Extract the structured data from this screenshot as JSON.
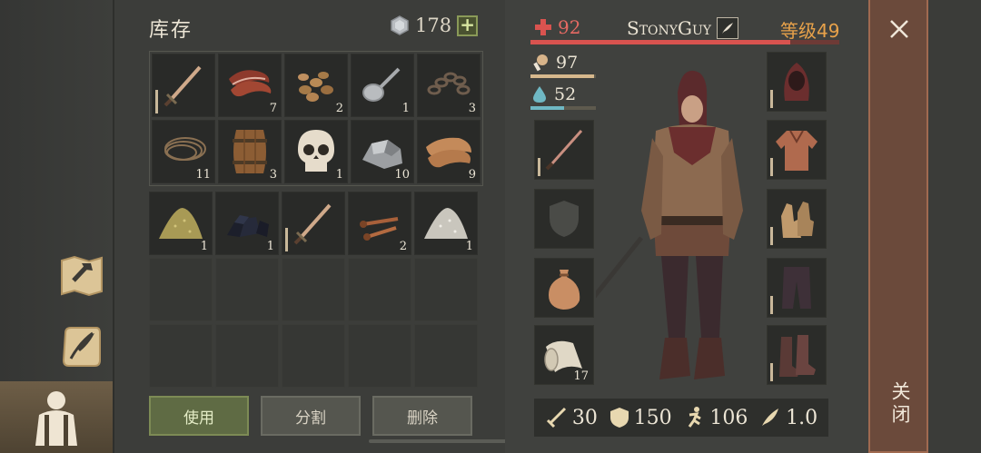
{
  "inventory": {
    "title": "库存",
    "silver": "178",
    "add_icon": "plus-icon",
    "top_grid": [
      {
        "name": "sword",
        "qty": ""
      },
      {
        "name": "bacon",
        "qty": "7"
      },
      {
        "name": "seeds",
        "qty": "2"
      },
      {
        "name": "spoon",
        "qty": "1"
      },
      {
        "name": "chain",
        "qty": "3"
      },
      {
        "name": "rope",
        "qty": "11"
      },
      {
        "name": "barrel",
        "qty": "3"
      },
      {
        "name": "skull",
        "qty": "1"
      },
      {
        "name": "ore",
        "qty": "10"
      },
      {
        "name": "leather",
        "qty": "9"
      }
    ],
    "bottom_grid": [
      {
        "name": "sand",
        "qty": "1"
      },
      {
        "name": "coal",
        "qty": "1"
      },
      {
        "name": "sword",
        "qty": ""
      },
      {
        "name": "nails",
        "qty": "2"
      },
      {
        "name": "salt",
        "qty": "1"
      }
    ],
    "actions": {
      "use": "使用",
      "split": "分割",
      "delete": "删除"
    }
  },
  "character": {
    "hp": "92",
    "name": "StonyGuy",
    "level": "等级49",
    "hp_ratio": 0.84,
    "food": "97",
    "food_ratio": 0.97,
    "water": "52",
    "water_ratio": 0.52,
    "left_slots": [
      {
        "name": "weapon",
        "qty": ""
      },
      {
        "name": "shield",
        "qty": ""
      },
      {
        "name": "bag",
        "qty": ""
      },
      {
        "name": "scroll",
        "qty": "17"
      }
    ],
    "right_slots": [
      "hood",
      "shirt",
      "gloves",
      "pants",
      "boots"
    ],
    "combat": {
      "attack": "30",
      "defense": "150",
      "speed": "106",
      "weight": "1.0"
    }
  },
  "close": {
    "label": "关闭"
  }
}
